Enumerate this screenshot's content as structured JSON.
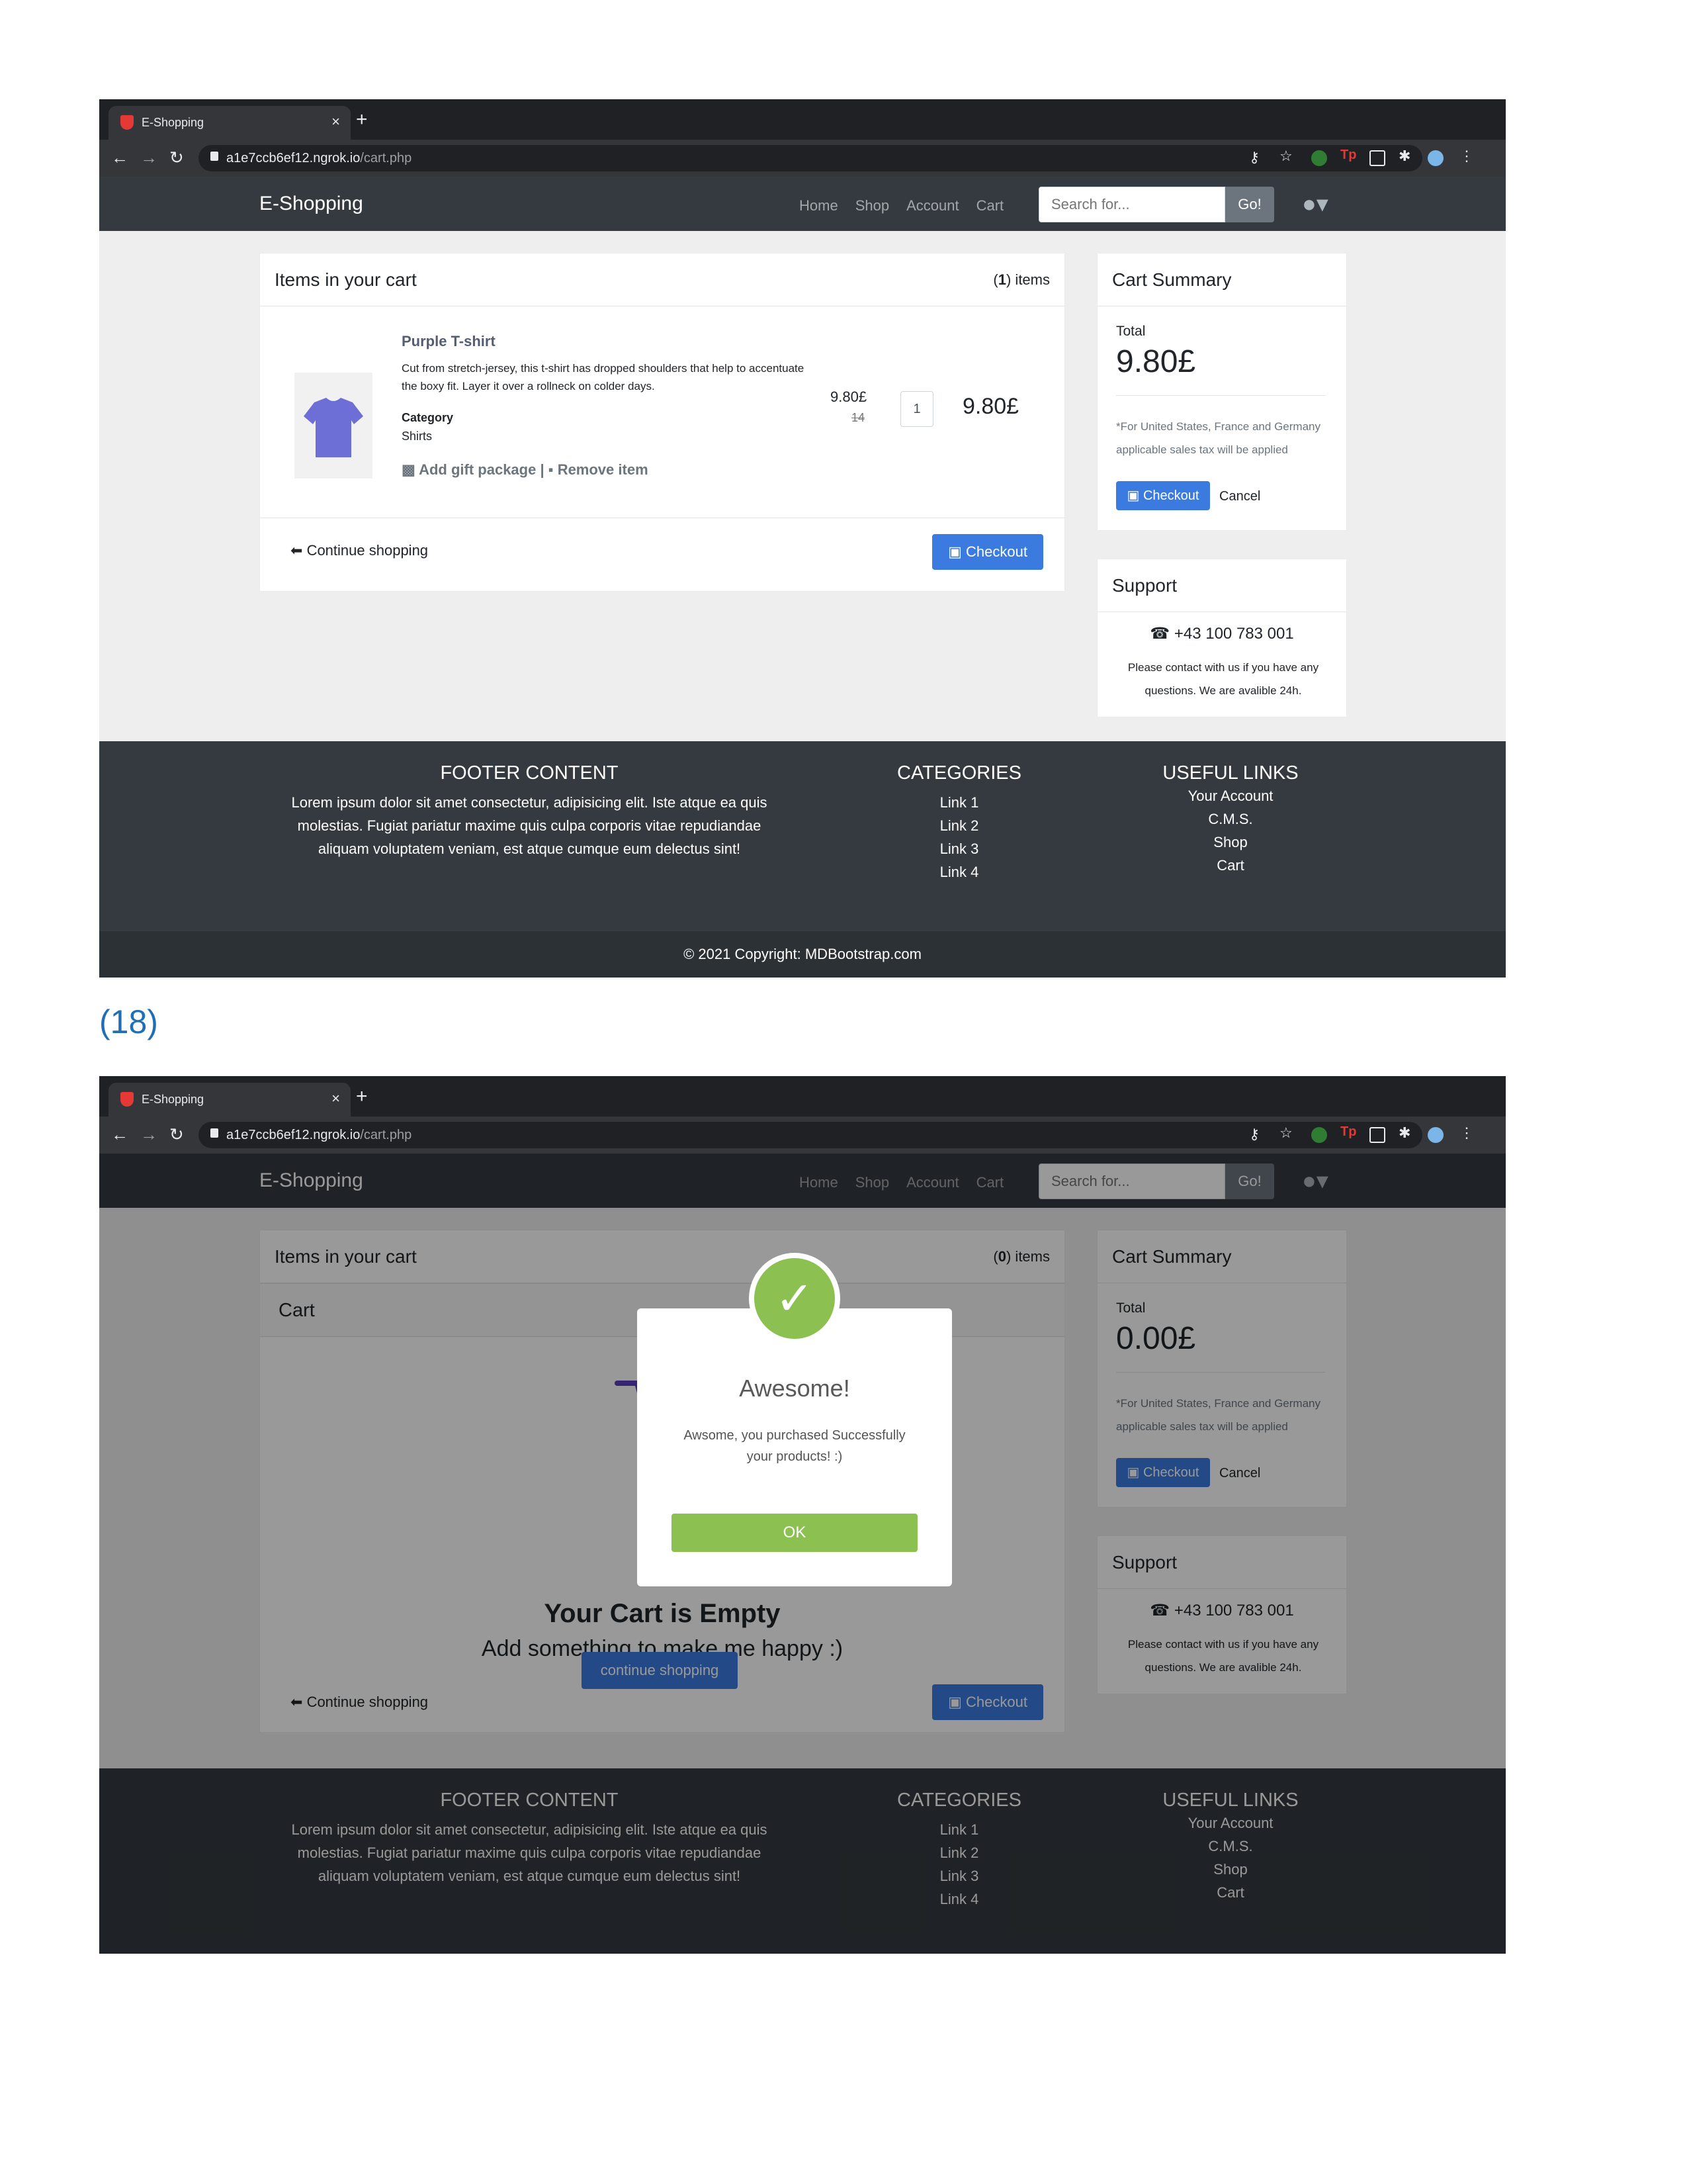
{
  "browser": {
    "tab_title": "E-Shopping",
    "tab_close": "×",
    "new_tab": "+",
    "url_host": "a1e7ccb6ef12.ngrok.io",
    "url_path": "/cart.php"
  },
  "navbar": {
    "brand": "E-Shopping",
    "links": [
      "Home",
      "Shop",
      "Account",
      "Cart"
    ],
    "search_placeholder": "Search for...",
    "search_button": "Go!"
  },
  "cart": {
    "title": "Items in your cart",
    "count_before": "1",
    "count_after": "0",
    "count_suffix": " items",
    "product": {
      "name": "Purple T-shirt",
      "description": "Cut from stretch-jersey, this t-shirt has dropped shoulders that help to accentuate the boxy fit. Layer it over a rollneck on colder days.",
      "category_label": "Category",
      "category": "Shirts",
      "gift_action": "Add gift package",
      "separator": "|",
      "remove_action": "Remove item",
      "unit_price": "9.80£",
      "old_price": "14",
      "quantity": "1",
      "line_total": "9.80£"
    },
    "continue": "Continue shopping",
    "checkout": "Checkout",
    "inner_header": "Cart",
    "empty_title": "Your Cart is Empty",
    "empty_subtitle": "Add something to make me happy :)",
    "empty_button": "continue shopping"
  },
  "summary": {
    "title": "Cart Summary",
    "total_label": "Total",
    "total_before": "9.80£",
    "total_after": "0.00£",
    "note": "*For United States, France and Germany applicable sales tax will be applied",
    "checkout": "Checkout",
    "cancel": "Cancel"
  },
  "support": {
    "title": "Support",
    "phone": "+43 100 783 001",
    "text": "Please contact with us if you have any questions. We are avalible 24h."
  },
  "footer": {
    "content_title": "FOOTER CONTENT",
    "content_text": "Lorem ipsum dolor sit amet consectetur, adipisicing elit. Iste atque ea quis molestias. Fugiat pariatur maxime quis culpa corporis vitae repudiandae aliquam voluptatem veniam, est atque cumque eum delectus sint!",
    "categories_title": "CATEGORIES",
    "categories": [
      "Link 1",
      "Link 2",
      "Link 3",
      "Link 4"
    ],
    "useful_title": "USEFUL LINKS",
    "useful": [
      "Your Account",
      "C.M.S.",
      "Shop",
      "Cart"
    ],
    "copyright": "© 2021 Copyright: MDBootstrap.com"
  },
  "caption": "(18)",
  "modal": {
    "title": "Awesome!",
    "text": "Awsome, you purchased Successfully your products! :)",
    "ok": "OK"
  },
  "icons": {
    "check": "✓",
    "arrow_left": "🡐",
    "cart": "🛒",
    "phone": "☎",
    "gift": "🎁",
    "trash": "🗑",
    "user": "👤",
    "lock": "lock",
    "key": "⚷",
    "star": "☆",
    "puzzle": "✱",
    "menu": "⋮"
  },
  "colors": {
    "primary": "#3b7be0",
    "navbar": "#343a40",
    "success": "#8cc152"
  }
}
